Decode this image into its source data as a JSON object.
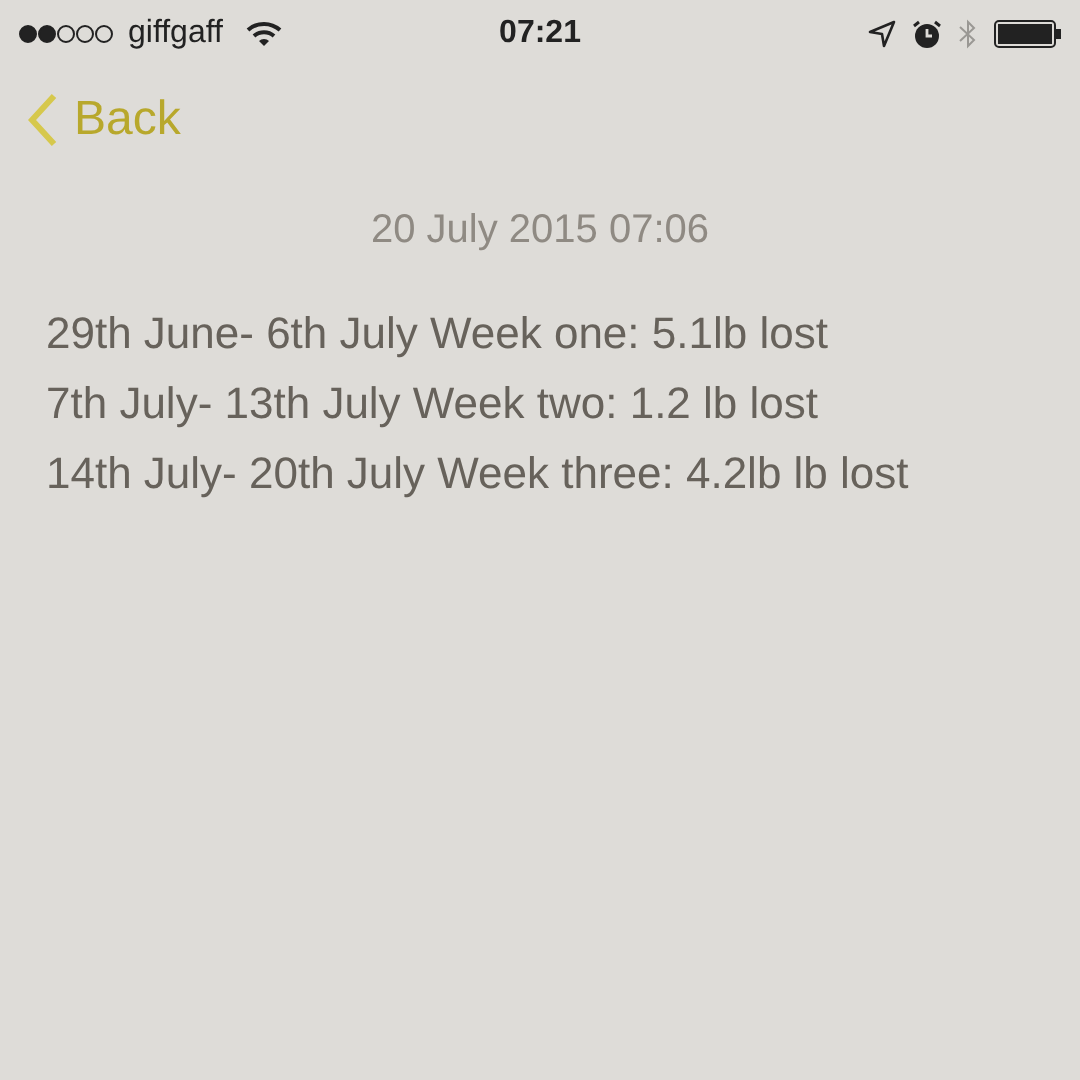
{
  "status_bar": {
    "carrier": "giffgaff",
    "time": "07:21"
  },
  "nav": {
    "back": "Back"
  },
  "note": {
    "date": "20 July 2015 07:06",
    "lines": [
      "29th June- 6th July Week one: 5.1lb lost",
      "7th July- 13th July Week two: 1.2 lb lost",
      "14th July- 20th July Week three: 4.2lb lb lost"
    ]
  }
}
